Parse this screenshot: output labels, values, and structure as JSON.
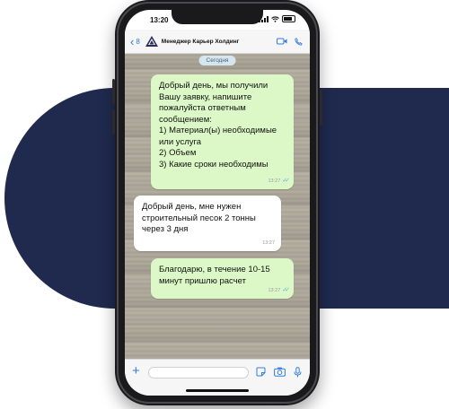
{
  "colors": {
    "accent": "#2f7de1",
    "backdrop_shape": "#1f2a4e",
    "outgoing_bubble": "#dcf8c6",
    "incoming_bubble": "#ffffff",
    "read_ticks": "#4fb6ec"
  },
  "status_bar": {
    "time": "13:20",
    "icons": [
      "signal-icon",
      "wifi-icon",
      "battery-icon"
    ]
  },
  "chat_header": {
    "back_icon": "chevron-left-icon",
    "back_count": "8",
    "logo_icon": "company-logo",
    "contact_name": "Менеджер Карьер Холдинг",
    "video_call_icon": "video-camera-icon",
    "call_icon": "phone-icon"
  },
  "chat": {
    "date_label": "Сегодня",
    "messages": [
      {
        "direction": "outgoing",
        "text": "Добрый день, мы получили Вашу заявку, напишите пожалуйста ответным сообщением:\n1) Материал(ы) необходимые или услуга\n2) Объем\n3) Какие сроки необходимы",
        "time": "13:27",
        "status": "read"
      },
      {
        "direction": "incoming",
        "text": "Добрый день, мне нужен строительный песок 2 тонны через 3 дня",
        "time": "13:27"
      },
      {
        "direction": "outgoing",
        "text": "Благодарю, в течение 10-15 минут пришлю расчет",
        "time": "13:27",
        "status": "read"
      }
    ]
  },
  "input_bar": {
    "attach_icon": "plus-icon",
    "message_value": "",
    "sticker_icon": "sticker-icon",
    "camera_icon": "camera-icon",
    "mic_icon": "microphone-icon"
  }
}
